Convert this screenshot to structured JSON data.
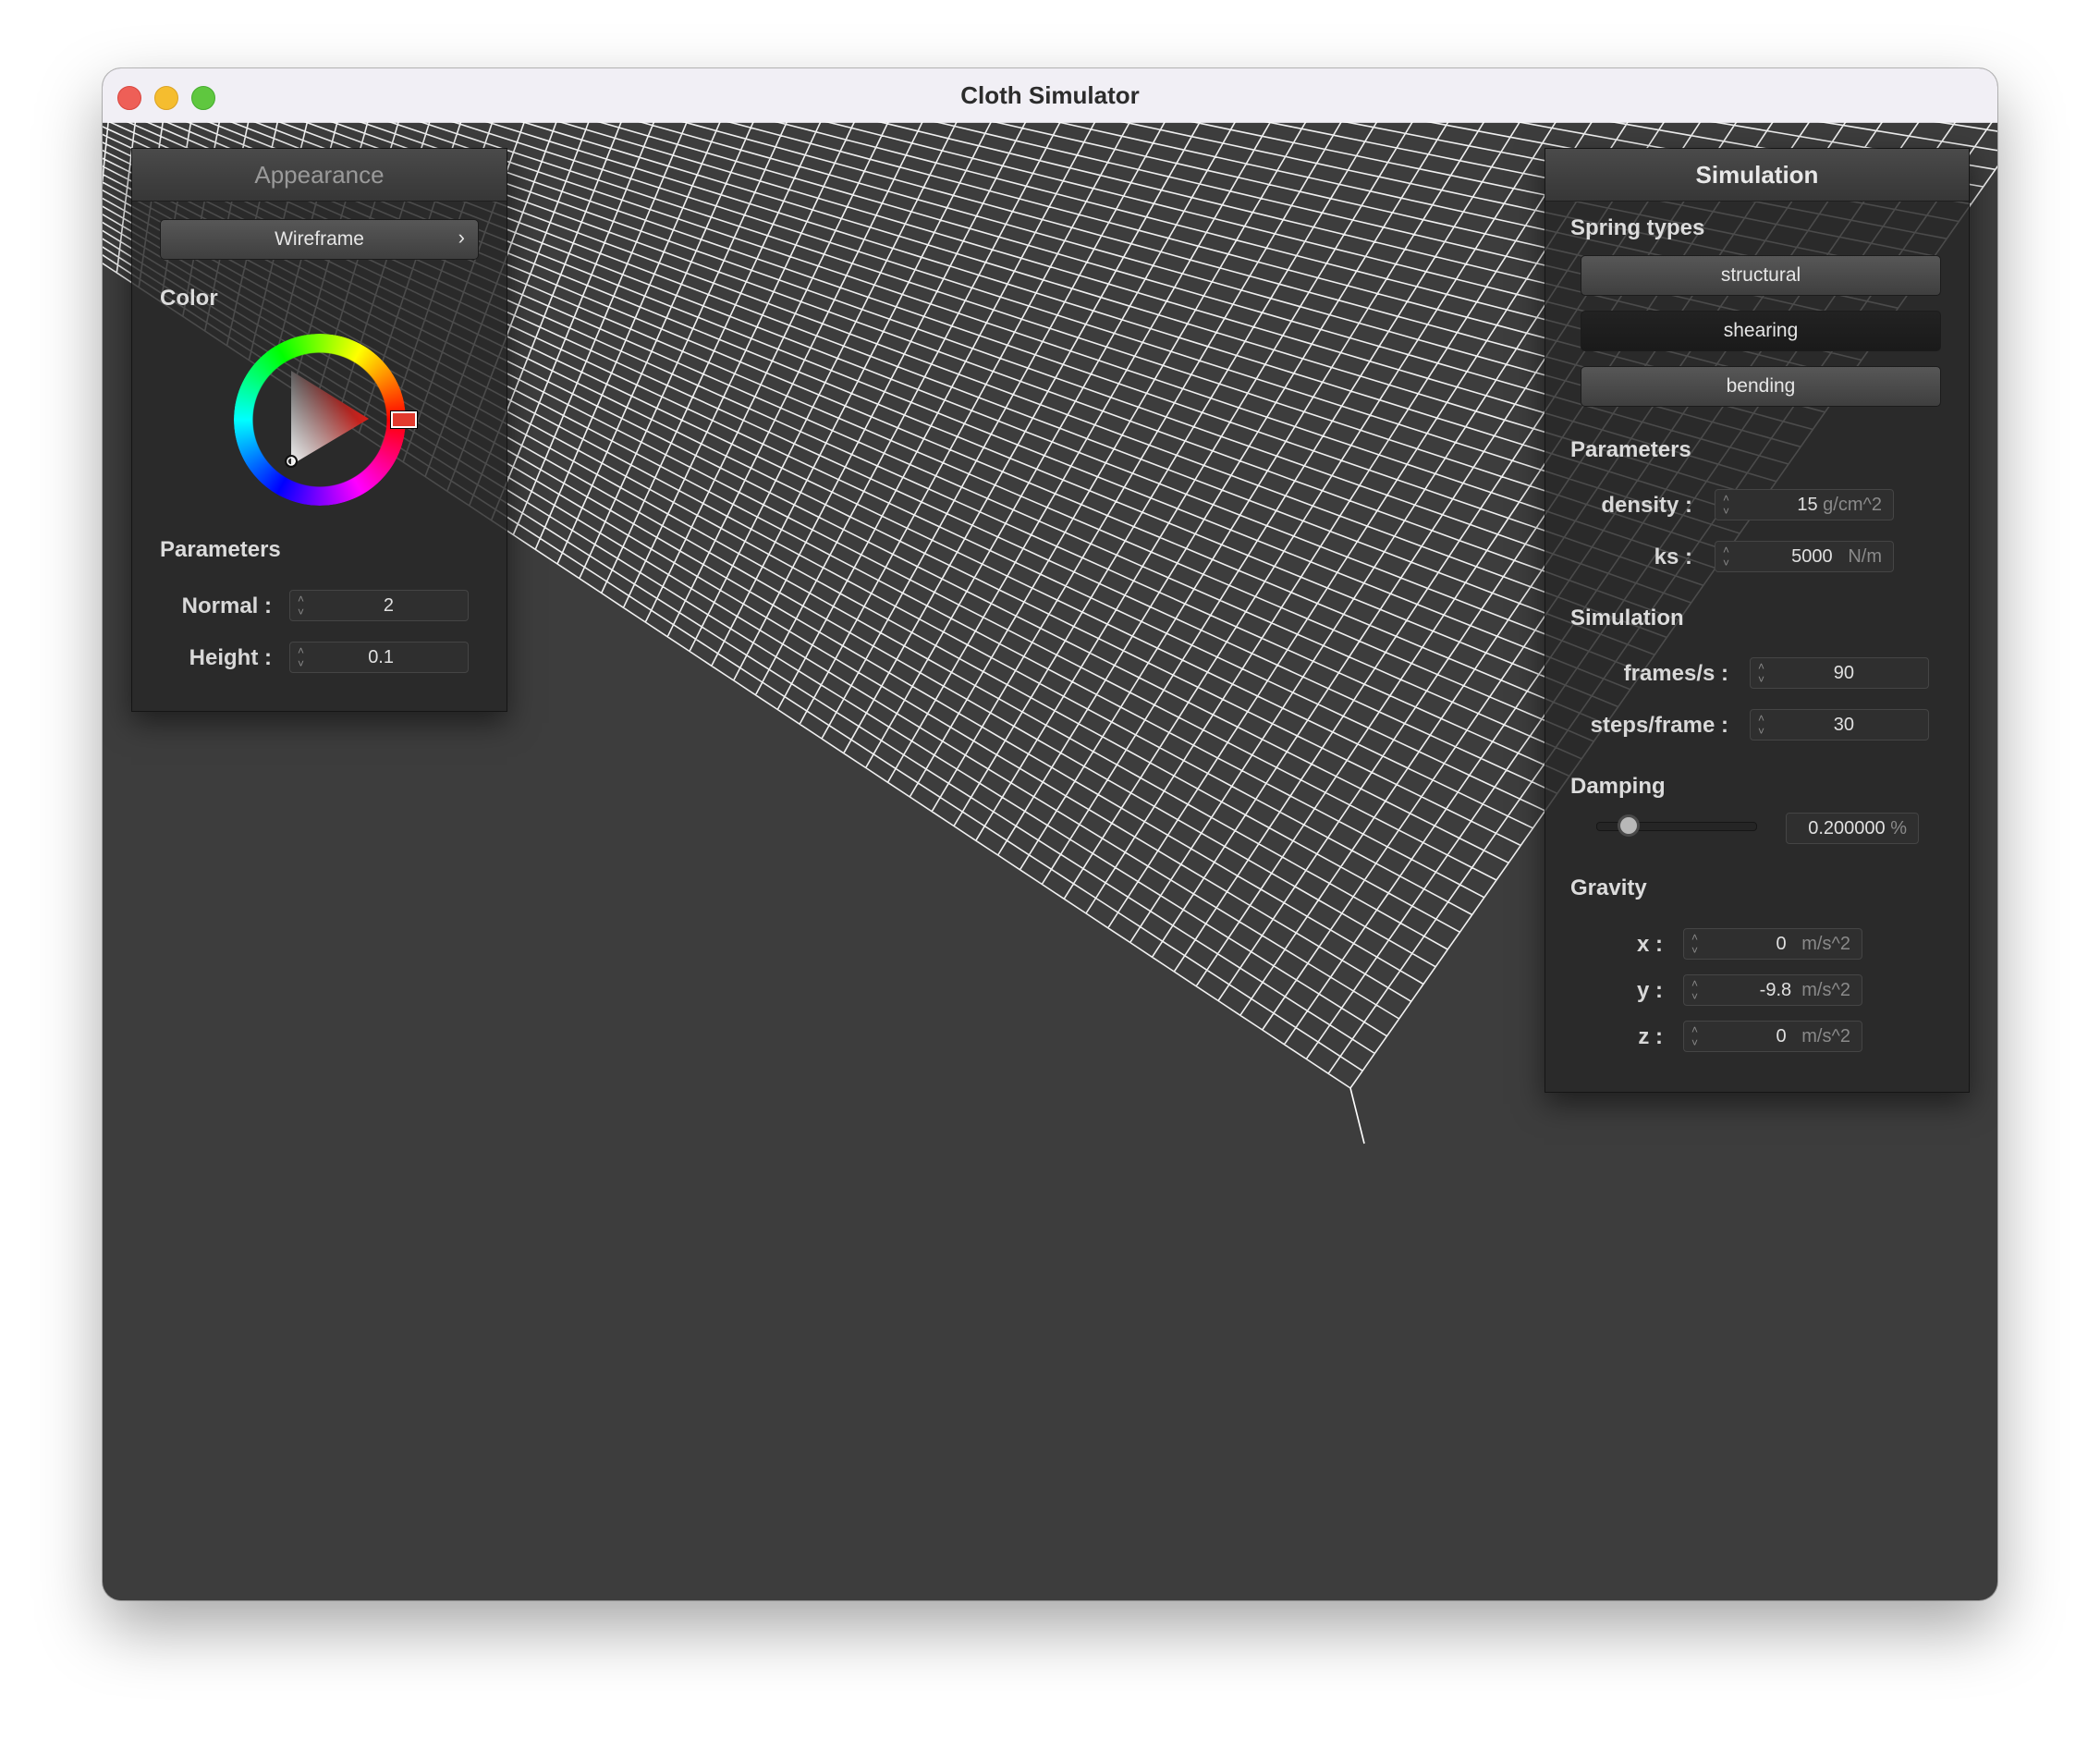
{
  "window": {
    "title": "Cloth Simulator"
  },
  "appearance": {
    "header": "Appearance",
    "shader_button": "Wireframe",
    "shader_chevron": "›",
    "color_label": "Color",
    "selected_color": "#d91e18",
    "parameters_label": "Parameters",
    "normal": {
      "label": "Normal :",
      "value": "2"
    },
    "height": {
      "label": "Height :",
      "value": "0.1"
    }
  },
  "simulation": {
    "header": "Simulation",
    "spring_types_label": "Spring types",
    "springs": [
      {
        "label": "structural",
        "pressed": false
      },
      {
        "label": "shearing",
        "pressed": true
      },
      {
        "label": "bending",
        "pressed": false
      }
    ],
    "parameters_label": "Parameters",
    "density": {
      "label": "density :",
      "value": "15",
      "unit": "g/cm^2"
    },
    "ks": {
      "label": "ks :",
      "value": "5000",
      "unit": "N/m"
    },
    "simulation_label": "Simulation",
    "frames": {
      "label": "frames/s :",
      "value": "90"
    },
    "steps": {
      "label": "steps/frame :",
      "value": "30"
    },
    "damping_label": "Damping",
    "damping": {
      "value": "0.200000",
      "unit": "%",
      "fraction": 0.2
    },
    "gravity_label": "Gravity",
    "gravity": [
      {
        "label": "x :",
        "value": "0",
        "unit": "m/s^2"
      },
      {
        "label": "y :",
        "value": "-9.8",
        "unit": "m/s^2"
      },
      {
        "label": "z :",
        "value": "0",
        "unit": "m/s^2"
      }
    ]
  },
  "colors": {
    "viewport_bg": "#3d3d3d",
    "grid_line": "#ffffff"
  }
}
